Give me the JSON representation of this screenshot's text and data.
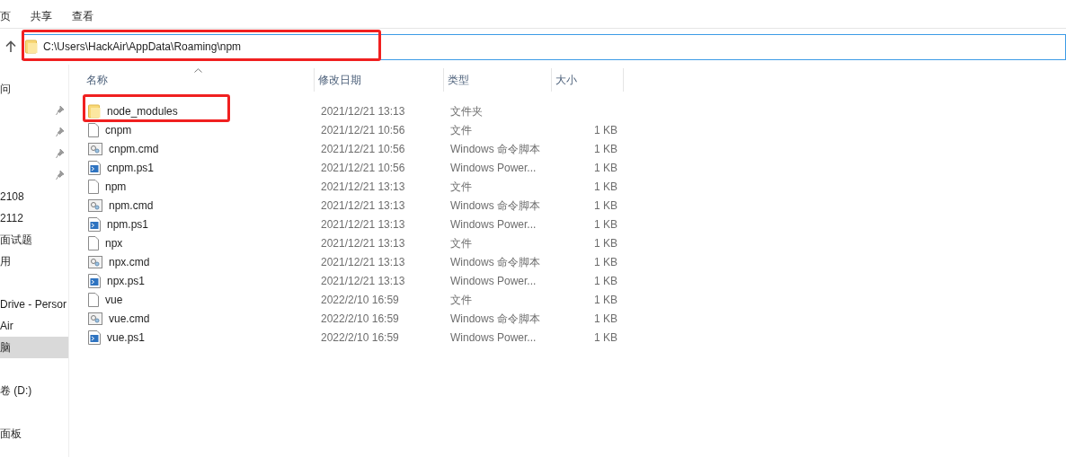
{
  "ribbon_tabs": [
    {
      "label": "页"
    },
    {
      "label": "共享"
    },
    {
      "label": "查看"
    }
  ],
  "address_bar": {
    "path": "C:\\Users\\HackAir\\AppData\\Roaming\\npm",
    "annotated": true
  },
  "sidebar": {
    "sections": [
      {
        "items": [
          {
            "kind": "label",
            "label": "问",
            "selected": false
          },
          {
            "kind": "pin",
            "selected": false
          },
          {
            "kind": "pin",
            "selected": false
          },
          {
            "kind": "pin",
            "selected": false
          },
          {
            "kind": "pin",
            "selected": false
          },
          {
            "kind": "label",
            "label": "2108",
            "selected": false
          },
          {
            "kind": "label",
            "label": "2112",
            "selected": false
          },
          {
            "kind": "label",
            "label": "面试题",
            "selected": false
          },
          {
            "kind": "label",
            "label": "用",
            "selected": false
          }
        ]
      },
      {
        "items": [
          {
            "kind": "label",
            "label": "Drive - Persor",
            "selected": false
          },
          {
            "kind": "label",
            "label": "Air",
            "selected": false
          },
          {
            "kind": "label",
            "label": "脑",
            "selected": true
          }
        ]
      },
      {
        "items": [
          {
            "kind": "label",
            "label": "卷 (D:)",
            "selected": false
          }
        ]
      },
      {
        "items": [
          {
            "kind": "label",
            "label": "面板",
            "selected": false
          }
        ]
      }
    ]
  },
  "table": {
    "columns": [
      "名称",
      "修改日期",
      "类型",
      "大小"
    ],
    "rows": [
      {
        "kind": "folder",
        "name": "node_modules",
        "date": "2021/12/21 13:13",
        "type": "文件夹",
        "annotated": true
      },
      {
        "kind": "file",
        "name": "cnpm",
        "date": "2021/12/21 10:56",
        "type": "文件",
        "size": "1 KB",
        "annotated": false
      },
      {
        "kind": "cmd",
        "name": "cnpm.cmd",
        "date": "2021/12/21 10:56",
        "type": "Windows 命令脚本",
        "size": "1 KB",
        "annotated": false
      },
      {
        "kind": "ps1",
        "name": "cnpm.ps1",
        "date": "2021/12/21 10:56",
        "type": "Windows Power...",
        "size": "1 KB",
        "annotated": false
      },
      {
        "kind": "file",
        "name": "npm",
        "date": "2021/12/21 13:13",
        "type": "文件",
        "size": "1 KB",
        "annotated": false
      },
      {
        "kind": "cmd",
        "name": "npm.cmd",
        "date": "2021/12/21 13:13",
        "type": "Windows 命令脚本",
        "size": "1 KB",
        "annotated": false
      },
      {
        "kind": "ps1",
        "name": "npm.ps1",
        "date": "2021/12/21 13:13",
        "type": "Windows Power...",
        "size": "1 KB",
        "annotated": false
      },
      {
        "kind": "file",
        "name": "npx",
        "date": "2021/12/21 13:13",
        "type": "文件",
        "size": "1 KB",
        "annotated": false
      },
      {
        "kind": "cmd",
        "name": "npx.cmd",
        "date": "2021/12/21 13:13",
        "type": "Windows 命令脚本",
        "size": "1 KB",
        "annotated": false
      },
      {
        "kind": "ps1",
        "name": "npx.ps1",
        "date": "2021/12/21 13:13",
        "type": "Windows Power...",
        "size": "1 KB",
        "annotated": false
      },
      {
        "kind": "file",
        "name": "vue",
        "date": "2022/2/10 16:59",
        "type": "文件",
        "size": "1 KB",
        "annotated": false
      },
      {
        "kind": "cmd",
        "name": "vue.cmd",
        "date": "2022/2/10 16:59",
        "type": "Windows 命令脚本",
        "size": "1 KB",
        "annotated": false
      },
      {
        "kind": "ps1",
        "name": "vue.ps1",
        "date": "2022/2/10 16:59",
        "type": "Windows Power...",
        "size": "1 KB",
        "annotated": false
      }
    ]
  }
}
